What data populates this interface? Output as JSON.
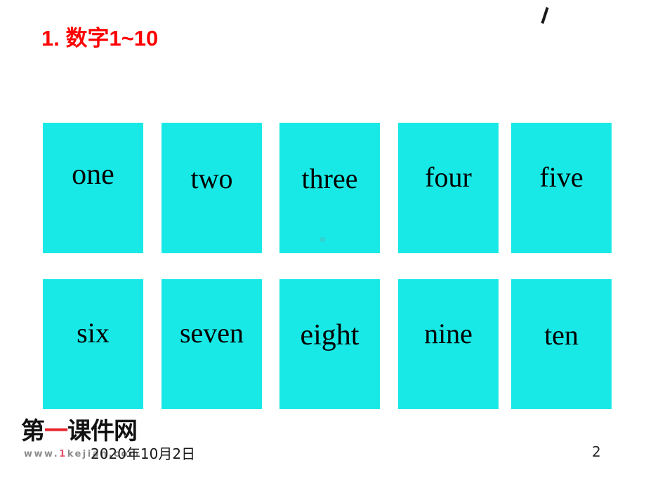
{
  "slide": {
    "background_color": "#ffffff",
    "page_number": "2",
    "title": "1. 数字1~10",
    "title_color": "#ff0000"
  },
  "marks": {
    "pen_stroke": "backslash-stroke-icon"
  },
  "cards": {
    "card_color": "#18e9e6",
    "text_color": "#000000",
    "rows": [
      {
        "row_label": "numbers-one-to-five",
        "items": [
          {
            "word": "one"
          },
          {
            "word": "two"
          },
          {
            "word": "three"
          },
          {
            "word": "four"
          },
          {
            "word": "five"
          }
        ]
      },
      {
        "row_label": "numbers-six-to-ten",
        "items": [
          {
            "word": "six"
          },
          {
            "word": "seven"
          },
          {
            "word": "eight"
          },
          {
            "word": "nine"
          },
          {
            "word": "ten"
          }
        ]
      }
    ]
  },
  "watermark": {
    "logo_part_1": "第",
    "logo_accent": "一",
    "logo_part_2": "课件网",
    "url_prefix": "www.",
    "url_accent": "1",
    "url_suffix": "kejian.com",
    "logo_color": "#111111",
    "accent_color": "#e8242a",
    "url_color": "#8c8c8c"
  },
  "footer": {
    "date": "2020年10月2日"
  }
}
